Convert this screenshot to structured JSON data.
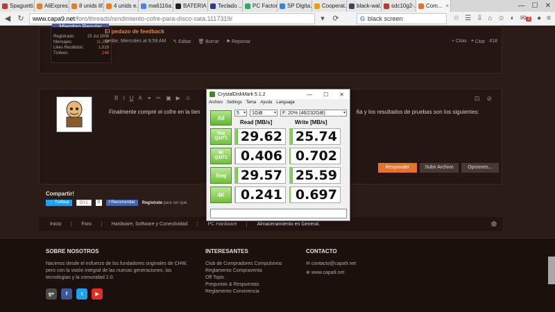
{
  "browser": {
    "tabs": [
      {
        "label": "Spaguetti...",
        "color": "#c0392b"
      },
      {
        "label": "AliExpres...",
        "color": "#e67e22"
      },
      {
        "label": "8 unids lif...",
        "color": "#e67e22"
      },
      {
        "label": "4 unids e...",
        "color": "#e67e22"
      },
      {
        "label": "ma6116a...",
        "color": "#4285f4"
      },
      {
        "label": "BATERIA ...",
        "color": "#222222"
      },
      {
        "label": "Teclado ...",
        "color": "#2c3e90"
      },
      {
        "label": "PC Factor...",
        "color": "#27ae60"
      },
      {
        "label": "SP Digita...",
        "color": "#2e86de"
      },
      {
        "label": "Cooperat...",
        "color": "#f39c12"
      },
      {
        "label": "black-wal...",
        "color": "#34495e"
      },
      {
        "label": "sdc10g2-...",
        "color": "#c0392b"
      },
      {
        "label": "Com...",
        "color": "#e8712a"
      }
    ],
    "url_domain": "www.capa9.net",
    "url_path": "/foro/threads/rendimiento-cofre-para-disco-sata.1117319/",
    "search_value": "black screen",
    "notification_count": "3",
    "window_controls": {
      "minimize": "—",
      "maximize": "☐",
      "close": "✕"
    }
  },
  "post1": {
    "member_role": "Miembro Regular",
    "stats": [
      {
        "label": "Registrado:",
        "value": "25 Jul 2006"
      },
      {
        "label": "Mensajes:",
        "value": "11,259"
      },
      {
        "label": "Likes Recibidos:",
        "value": "1,019"
      },
      {
        "label": "Trofeos:",
        "value": "148"
      }
    ],
    "feedback_title": "El pedazo de feedback",
    "meta_time": "senbe, Miercoles at 9:59 AM",
    "meta_edit": "Editar",
    "meta_delete": "Borrar",
    "meta_report": "Reportar",
    "action_quotes": "+ Citas",
    "action_quote": "Citar",
    "post_number": "#18"
  },
  "post2": {
    "text_start": "Finalmente compré el cofre en la tien",
    "text_end": "6a y los resultados de pruebas son los siguientes:",
    "btn_reply": "Responder",
    "btn_upload": "Subir Archivo",
    "btn_options": "Opciones..."
  },
  "share": {
    "title": "Compartir!",
    "twitter": "Twittear",
    "gplus": "G+1",
    "gplus_count": "0",
    "facebook": "Recomendar",
    "note_bold": "Registrate",
    "note": "para ver qué"
  },
  "crumbs": [
    "Inicio",
    "Foro",
    "Hardware, Software y Conectividad",
    "PC Hardware",
    "Almacenamiento en General."
  ],
  "footer": {
    "about_title": "SOBRE NOSOTROS",
    "about_text": "Nacimos desde el esfuerzo de los fundadores originales de CHW, pero con la visión integral de las nuevas generaciones, las tecnologías y la comunidad 2.0.",
    "interest_title": "INTERESANTES",
    "interest_links": [
      "Club de Compradores Compulsivos",
      "Reglamento Compraventa",
      "Off Topic",
      "Preguntas & Respuestas",
      "Reglamento Convivencia"
    ],
    "contact_title": "CONTACTO",
    "contact_email": "contacto@capa9.net",
    "contact_web": "www.capa9.net",
    "social": [
      {
        "label": "g+",
        "color": "#4a4a4a"
      },
      {
        "label": "f",
        "color": "#3b5998"
      },
      {
        "label": "t",
        "color": "#1da1f2"
      },
      {
        "label": "▶",
        "color": "#e52d27"
      }
    ]
  },
  "cdm": {
    "title": "CrystalDiskMark 5.1.2",
    "menu": [
      "Archivo",
      "Settings",
      "Tema",
      "Ayuda",
      "Language"
    ],
    "count": "5",
    "size": "1GiB",
    "drive": "F: 20% (46/232GiB)",
    "all_label": "All",
    "read_header": "Read [MB/s]",
    "write_header": "Write [MB/s]",
    "rows": [
      {
        "label1": "Seq",
        "label2": "Q32T1",
        "read": "29.62",
        "write": "25.74",
        "read_fill": 0.05,
        "write_fill": 0.05
      },
      {
        "label1": "4K",
        "label2": "Q32T1",
        "read": "0.406",
        "write": "0.702",
        "read_fill": 0.01,
        "write_fill": 0.01
      },
      {
        "label1": "Seq",
        "label2": "",
        "read": "29.57",
        "write": "25.59",
        "read_fill": 0.05,
        "write_fill": 0.05
      },
      {
        "label1": "4K",
        "label2": "",
        "read": "0.241",
        "write": "0.697",
        "read_fill": 0.01,
        "write_fill": 0.01
      }
    ]
  }
}
